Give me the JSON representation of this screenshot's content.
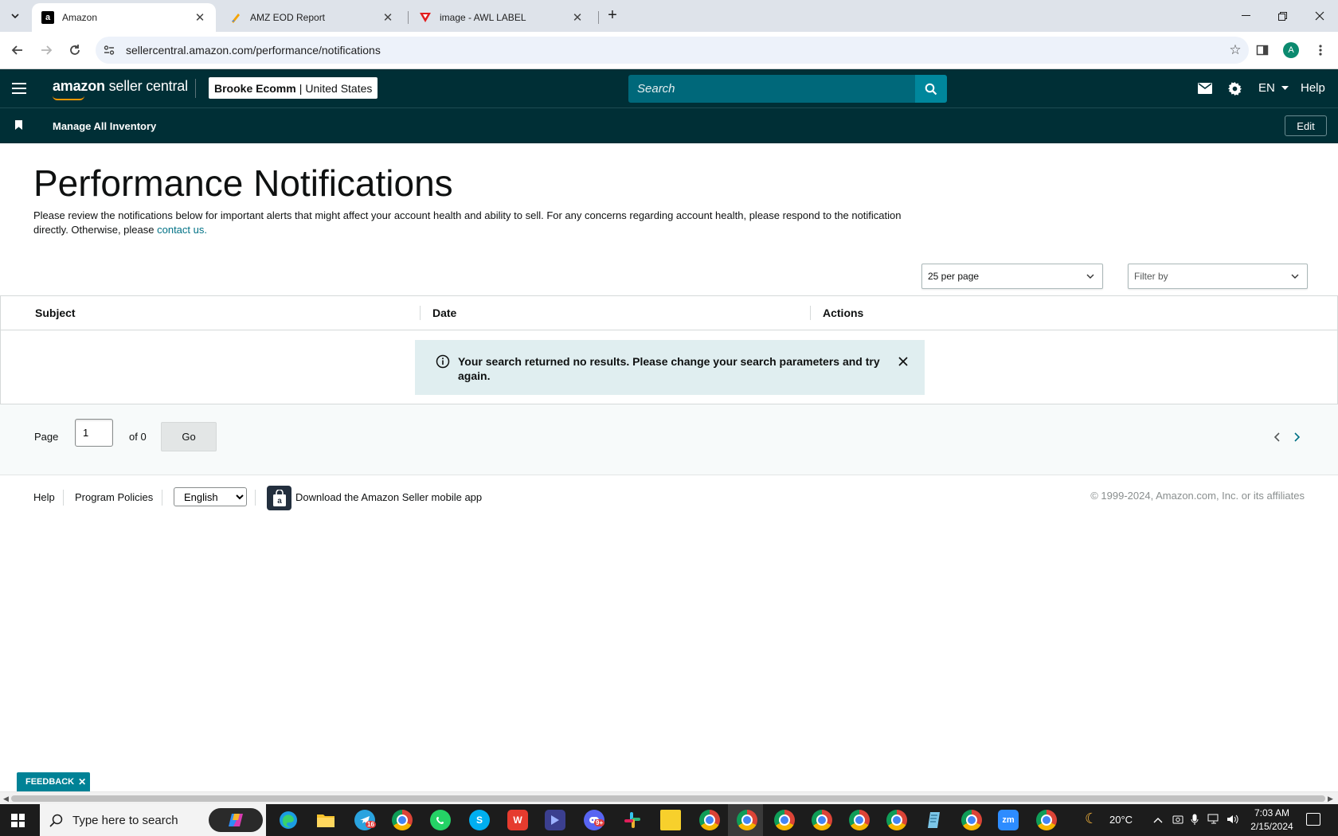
{
  "browser": {
    "tabs": [
      {
        "title": "Amazon",
        "favicon": "amazon-icon"
      },
      {
        "title": "AMZ EOD Report",
        "favicon": "sheets-icon"
      },
      {
        "title": "image - AWL LABEL",
        "favicon": "awl-icon"
      }
    ],
    "url": "sellercentral.amazon.com/performance/notifications",
    "profile_initial": "A"
  },
  "header": {
    "logo_brand": "amazon",
    "logo_suffix": " seller central",
    "store_name": "Brooke Ecomm",
    "store_divider": "|",
    "marketplace": "United States",
    "search_placeholder": "Search",
    "language": "EN",
    "help": "Help"
  },
  "subnav": {
    "bookmark": "Manage All Inventory",
    "edit": "Edit"
  },
  "page": {
    "title": "Performance Notifications",
    "description": "Please review the notifications below for important alerts that might affect your account health and ability to sell. For any concerns regarding account health, please respond to the notification directly. Otherwise, please ",
    "contact_link": "contact us."
  },
  "controls": {
    "per_page": "25 per page",
    "filter": "Filter by"
  },
  "table": {
    "columns": [
      "Subject",
      "Date",
      "Actions"
    ],
    "empty_message": "Your search returned no results. Please change your search parameters and try again."
  },
  "pagination": {
    "page_label": "Page",
    "current_page": "1",
    "of_label": "of 0",
    "go": "Go"
  },
  "footer": {
    "help": "Help",
    "program_policies": "Program Policies",
    "language": "English",
    "app_link": "Download the Amazon Seller mobile app",
    "copyright": "© 1999-2024, Amazon.com, Inc. or its affiliates"
  },
  "feedback": "FEEDBACK",
  "taskbar": {
    "search_placeholder": "Type here to search",
    "weather": "20°C",
    "time": "7:03 AM",
    "date": "2/15/2024",
    "telegram_badge": "16",
    "discord_badge": "9+"
  },
  "colors": {
    "header_bg": "#002f36",
    "search_bg": "#00687a",
    "search_button": "#00879c",
    "link": "#007185",
    "alert_bg": "#e0eef0",
    "feedback_bg": "#008296"
  }
}
